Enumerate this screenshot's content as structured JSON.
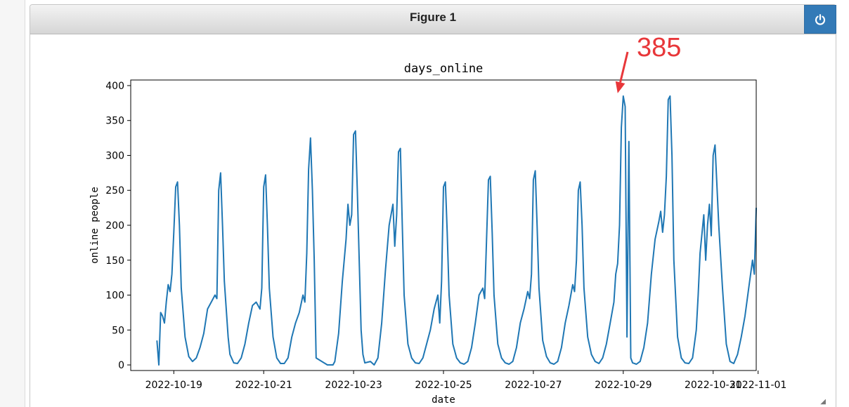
{
  "window": {
    "title": "Figure 1",
    "power_icon": "power-icon",
    "resize_icon": "resize-grip-icon"
  },
  "colors": {
    "line": "#1f77b4",
    "annotation": "#e8373a",
    "titlebar_button": "#337ab7"
  },
  "annotation": {
    "text": "385",
    "target_date": "2022-10-28 21:00",
    "target_value": 385
  },
  "chart_data": {
    "type": "line",
    "title": "days_online",
    "xlabel": "date",
    "ylabel": "online people",
    "xlim": [
      "2022-10-18 01:00",
      "2022-10-31 23:00"
    ],
    "ylim": [
      -8,
      408
    ],
    "yticks": [
      0,
      50,
      100,
      150,
      200,
      250,
      300,
      350,
      400
    ],
    "xticks": [
      "2022-10-19",
      "2022-10-21",
      "2022-10-23",
      "2022-10-25",
      "2022-10-27",
      "2022-10-29",
      "2022-10-31",
      "2022-11-01"
    ],
    "xtick_labels": [
      "2022-10-19",
      "2022-10-21",
      "2022-10-23",
      "2022-10-25",
      "2022-10-27",
      "2022-10-29",
      "2022-10-31",
      "2022-11-01"
    ],
    "grid": false,
    "series": [
      {
        "x": [
          "2022-10-18 15:00",
          "2022-10-18 16:00",
          "2022-10-18 17:00",
          "2022-10-18 18:00",
          "2022-10-18 19:00",
          "2022-10-18 20:00",
          "2022-10-18 21:00",
          "2022-10-18 22:00",
          "2022-10-18 23:00",
          "2022-10-19 00:00",
          "2022-10-19 01:00",
          "2022-10-19 02:00",
          "2022-10-19 03:00",
          "2022-10-19 04:00",
          "2022-10-19 06:00",
          "2022-10-19 08:00",
          "2022-10-19 10:00",
          "2022-10-19 12:00",
          "2022-10-19 14:00",
          "2022-10-19 16:00",
          "2022-10-19 18:00",
          "2022-10-19 20:00",
          "2022-10-19 22:00",
          "2022-10-19 23:00",
          "2022-10-20 00:00",
          "2022-10-20 01:00",
          "2022-10-20 02:00",
          "2022-10-20 03:00",
          "2022-10-20 05:00",
          "2022-10-20 06:00",
          "2022-10-20 08:00",
          "2022-10-20 10:00",
          "2022-10-20 12:00",
          "2022-10-20 14:00",
          "2022-10-20 16:00",
          "2022-10-20 18:00",
          "2022-10-20 20:00",
          "2022-10-20 22:00",
          "2022-10-20 23:00",
          "2022-10-21 00:00",
          "2022-10-21 01:00",
          "2022-10-21 02:00",
          "2022-10-21 03:00",
          "2022-10-21 05:00",
          "2022-10-21 07:00",
          "2022-10-21 09:00",
          "2022-10-21 11:00",
          "2022-10-21 13:00",
          "2022-10-21 15:00",
          "2022-10-21 17:00",
          "2022-10-21 19:00",
          "2022-10-21 21:00",
          "2022-10-21 22:00",
          "2022-10-21 23:00",
          "2022-10-22 00:00",
          "2022-10-22 01:00",
          "2022-10-22 02:00",
          "2022-10-22 03:00",
          "2022-10-22 04:00",
          "2022-10-22 10:00",
          "2022-10-22 13:00",
          "2022-10-22 14:00",
          "2022-10-22 16:00",
          "2022-10-22 18:00",
          "2022-10-22 20:00",
          "2022-10-22 21:00",
          "2022-10-22 22:00",
          "2022-10-22 23:00",
          "2022-10-23 00:00",
          "2022-10-23 01:00",
          "2022-10-23 02:00",
          "2022-10-23 03:00",
          "2022-10-23 04:00",
          "2022-10-23 05:00",
          "2022-10-23 06:00",
          "2022-10-23 09:00",
          "2022-10-23 11:00",
          "2022-10-23 13:00",
          "2022-10-23 15:00",
          "2022-10-23 17:00",
          "2022-10-23 19:00",
          "2022-10-23 21:00",
          "2022-10-23 22:00",
          "2022-10-23 23:00",
          "2022-10-24 00:00",
          "2022-10-24 01:00",
          "2022-10-24 02:00",
          "2022-10-24 03:00",
          "2022-10-24 05:00",
          "2022-10-24 07:00",
          "2022-10-24 09:00",
          "2022-10-24 11:00",
          "2022-10-24 13:00",
          "2022-10-24 15:00",
          "2022-10-24 17:00",
          "2022-10-24 19:00",
          "2022-10-24 21:00",
          "2022-10-24 22:00",
          "2022-10-24 23:00",
          "2022-10-25 00:00",
          "2022-10-25 01:00",
          "2022-10-25 02:00",
          "2022-10-25 03:00",
          "2022-10-25 05:00",
          "2022-10-25 07:00",
          "2022-10-25 09:00",
          "2022-10-25 11:00",
          "2022-10-25 13:00",
          "2022-10-25 15:00",
          "2022-10-25 17:00",
          "2022-10-25 19:00",
          "2022-10-25 21:00",
          "2022-10-25 22:00",
          "2022-10-25 23:00",
          "2022-10-26 00:00",
          "2022-10-26 01:00",
          "2022-10-26 02:00",
          "2022-10-26 03:00",
          "2022-10-26 05:00",
          "2022-10-26 07:00",
          "2022-10-26 09:00",
          "2022-10-26 11:00",
          "2022-10-26 13:00",
          "2022-10-26 15:00",
          "2022-10-26 17:00",
          "2022-10-26 19:00",
          "2022-10-26 21:00",
          "2022-10-26 22:00",
          "2022-10-26 23:00",
          "2022-10-27 00:00",
          "2022-10-27 01:00",
          "2022-10-27 02:00",
          "2022-10-27 03:00",
          "2022-10-27 05:00",
          "2022-10-27 07:00",
          "2022-10-27 09:00",
          "2022-10-27 11:00",
          "2022-10-27 13:00",
          "2022-10-27 15:00",
          "2022-10-27 17:00",
          "2022-10-27 19:00",
          "2022-10-27 21:00",
          "2022-10-27 22:00",
          "2022-10-27 23:00",
          "2022-10-28 00:00",
          "2022-10-28 01:00",
          "2022-10-28 02:00",
          "2022-10-28 03:00",
          "2022-10-28 05:00",
          "2022-10-28 07:00",
          "2022-10-28 09:00",
          "2022-10-28 11:00",
          "2022-10-28 13:00",
          "2022-10-28 15:00",
          "2022-10-28 17:00",
          "2022-10-28 19:00",
          "2022-10-28 20:00",
          "2022-10-28 21:00",
          "2022-10-28 22:00",
          "2022-10-28 23:00",
          "2022-10-29 00:00",
          "2022-10-29 01:00",
          "2022-10-29 02:00",
          "2022-10-29 03:00",
          "2022-10-29 04:00",
          "2022-10-29 05:00",
          "2022-10-29 07:00",
          "2022-10-29 09:00",
          "2022-10-29 11:00",
          "2022-10-29 13:00",
          "2022-10-29 15:00",
          "2022-10-29 17:00",
          "2022-10-29 19:00",
          "2022-10-29 20:00",
          "2022-10-29 21:00",
          "2022-10-29 22:00",
          "2022-10-29 23:00",
          "2022-10-30 00:00",
          "2022-10-30 01:00",
          "2022-10-30 02:00",
          "2022-10-30 03:00",
          "2022-10-30 05:00",
          "2022-10-30 07:00",
          "2022-10-30 09:00",
          "2022-10-30 11:00",
          "2022-10-30 13:00",
          "2022-10-30 15:00",
          "2022-10-30 16:00",
          "2022-10-30 17:00",
          "2022-10-30 19:00",
          "2022-10-30 20:00",
          "2022-10-30 21:00",
          "2022-10-30 22:00",
          "2022-10-30 23:00",
          "2022-10-31 00:00",
          "2022-10-31 01:00",
          "2022-10-31 03:00",
          "2022-10-31 05:00",
          "2022-10-31 07:00",
          "2022-10-31 09:00",
          "2022-10-31 11:00",
          "2022-10-31 13:00",
          "2022-10-31 15:00",
          "2022-10-31 17:00",
          "2022-10-31 19:00",
          "2022-10-31 21:00",
          "2022-10-31 22:00",
          "2022-10-31 23:00"
        ],
        "y": [
          35,
          0,
          75,
          70,
          60,
          90,
          115,
          105,
          130,
          190,
          255,
          262,
          200,
          110,
          40,
          12,
          5,
          10,
          25,
          45,
          80,
          90,
          100,
          95,
          250,
          275,
          200,
          120,
          40,
          15,
          3,
          2,
          10,
          30,
          60,
          85,
          90,
          80,
          110,
          255,
          272,
          200,
          110,
          40,
          10,
          2,
          2,
          10,
          40,
          60,
          75,
          100,
          90,
          160,
          280,
          325,
          250,
          150,
          10,
          0,
          0,
          5,
          45,
          120,
          180,
          230,
          200,
          215,
          330,
          335,
          250,
          150,
          50,
          15,
          3,
          5,
          0,
          10,
          60,
          135,
          200,
          230,
          170,
          215,
          305,
          310,
          200,
          100,
          30,
          10,
          3,
          2,
          10,
          30,
          50,
          80,
          100,
          60,
          120,
          255,
          262,
          190,
          100,
          30,
          10,
          3,
          1,
          5,
          25,
          60,
          100,
          110,
          95,
          180,
          265,
          270,
          190,
          100,
          30,
          10,
          3,
          1,
          5,
          25,
          60,
          80,
          105,
          95,
          130,
          265,
          278,
          200,
          110,
          35,
          12,
          3,
          1,
          5,
          25,
          60,
          85,
          115,
          105,
          150,
          250,
          262,
          200,
          110,
          40,
          15,
          5,
          2,
          10,
          30,
          60,
          90,
          130,
          145,
          200,
          340,
          385,
          370,
          40,
          320,
          10,
          3,
          1,
          5,
          25,
          60,
          130,
          180,
          205,
          220,
          190,
          215,
          270,
          380,
          385,
          300,
          150,
          40,
          10,
          3,
          2,
          10,
          50,
          100,
          160,
          215,
          150,
          200,
          230,
          185,
          300,
          315,
          200,
          110,
          30,
          5,
          2,
          15,
          40,
          70,
          110,
          150,
          130,
          225
        ]
      }
    ]
  }
}
